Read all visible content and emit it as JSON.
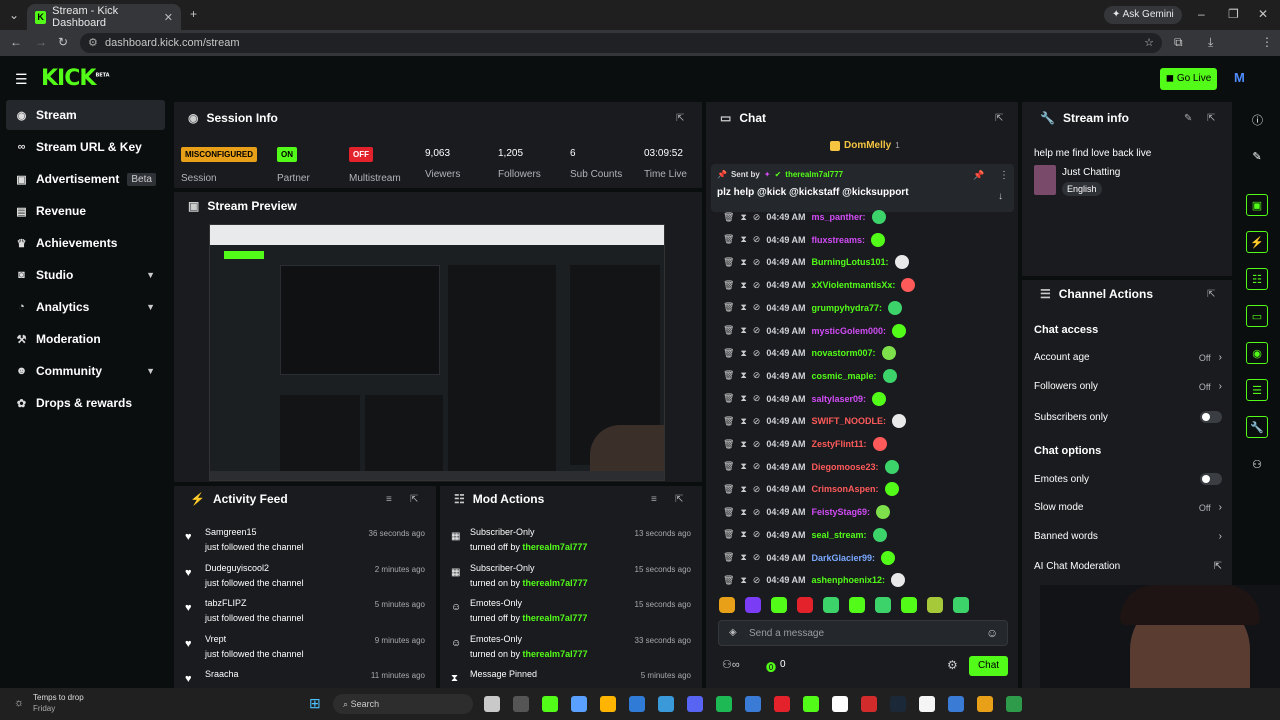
{
  "browser": {
    "tab_title": "Stream - Kick Dashboard",
    "url": "dashboard.kick.com/stream",
    "gemini": "Ask Gemini",
    "profile": "M7"
  },
  "header": {
    "logo": "KICK",
    "logo_sup": "BETA",
    "go_live": "Go Live"
  },
  "sidebar": {
    "items": [
      {
        "label": "Stream",
        "icon": "signal-icon"
      },
      {
        "label": "Stream URL & Key",
        "icon": "link-icon"
      },
      {
        "label": "Advertisement",
        "badge": "Beta",
        "icon": "monitor-icon"
      },
      {
        "label": "Revenue",
        "icon": "money-icon"
      },
      {
        "label": "Achievements",
        "icon": "trophy-icon"
      },
      {
        "label": "Studio",
        "icon": "camera-icon"
      },
      {
        "label": "Analytics",
        "icon": "chart-icon"
      },
      {
        "label": "Moderation",
        "icon": "hammer-icon"
      },
      {
        "label": "Community",
        "icon": "people-icon"
      },
      {
        "label": "Drops & rewards",
        "icon": "gift-icon"
      }
    ]
  },
  "session": {
    "title": "Session Info",
    "session_badge": "MISCONFIGURED",
    "session_label": "Session",
    "partner_badge": "ON",
    "partner_label": "Partner",
    "multistream_badge": "OFF",
    "multistream_label": "Multistream",
    "viewers": "9,063",
    "viewers_label": "Viewers",
    "followers": "1,205",
    "followers_label": "Followers",
    "subs": "6",
    "subs_label": "Sub Counts",
    "time": "03:09:52",
    "time_label": "Time Live"
  },
  "preview": {
    "title": "Stream Preview"
  },
  "activity": {
    "title": "Activity Feed",
    "items": [
      {
        "name": "Samgreen15",
        "action": "just followed the channel",
        "ago": "36 seconds ago"
      },
      {
        "name": "Dudeguyiscool2",
        "action": "just followed the channel",
        "ago": "2 minutes ago"
      },
      {
        "name": "tabzFLIPZ",
        "action": "just followed the channel",
        "ago": "5 minutes ago"
      },
      {
        "name": "Vrept",
        "action": "just followed the channel",
        "ago": "9 minutes ago"
      },
      {
        "name": "Sraacha",
        "action": "",
        "ago": "11 minutes ago"
      }
    ]
  },
  "mod": {
    "title": "Mod Actions",
    "items": [
      {
        "name": "Subscriber-Only",
        "pre": "turned off by",
        "by": "therealm7al777",
        "ago": "13 seconds ago"
      },
      {
        "name": "Subscriber-Only",
        "pre": "turned on by",
        "by": "therealm7al777",
        "ago": "15 seconds ago"
      },
      {
        "name": "Emotes-Only",
        "pre": "turned off by",
        "by": "therealm7al777",
        "ago": "15 seconds ago"
      },
      {
        "name": "Emotes-Only",
        "pre": "turned on by",
        "by": "therealm7al777",
        "ago": "33 seconds ago"
      },
      {
        "name": "Message Pinned",
        "pre": "",
        "by": "",
        "ago": "5 minutes ago"
      }
    ]
  },
  "chat": {
    "title": "Chat",
    "top_gifter": "DomMelly",
    "top_gifter_count": "1",
    "pinned_sent_by": "Sent by",
    "pinned_user": "therealm7al777",
    "pinned_text": "plz help @kick @kickstaff @kicksupport",
    "time": "04:49 AM",
    "messages": [
      {
        "user": "ms_panther:",
        "color": "#d14cf5"
      },
      {
        "user": "fluxstreams:",
        "color": "#d14cf5"
      },
      {
        "user": "BurningLotus101:",
        "color": "#53fc18"
      },
      {
        "user": "xXViolentmantisXx:",
        "color": "#53fc18"
      },
      {
        "user": "grumpyhydra77:",
        "color": "#53fc18"
      },
      {
        "user": "mysticGolem000:",
        "color": "#d14cf5"
      },
      {
        "user": "novastorm007:",
        "color": "#53fc18"
      },
      {
        "user": "cosmic_maple:",
        "color": "#53fc18"
      },
      {
        "user": "saltylaser09:",
        "color": "#d14cf5"
      },
      {
        "user": "SWIFT_NOODLE:",
        "color": "#ff5a5a"
      },
      {
        "user": "ZestyFlint11:",
        "color": "#ff5a5a"
      },
      {
        "user": "Diegomoose23:",
        "color": "#ff5a5a"
      },
      {
        "user": "CrimsonAspen:",
        "color": "#ff5a5a"
      },
      {
        "user": "FeistyStag69:",
        "color": "#d14cf5"
      },
      {
        "user": "seal_stream:",
        "color": "#53fc18"
      },
      {
        "user": "DarkGlacier99:",
        "color": "#7aa8ff"
      },
      {
        "user": "ashenphoenix12:",
        "color": "#53fc18"
      }
    ],
    "placeholder": "Send a message",
    "points": "0",
    "send": "Chat"
  },
  "stream_info": {
    "title": "Stream info",
    "stream_title": "help me find love back live",
    "category": "Just Chatting",
    "language": "English"
  },
  "channel_actions": {
    "title": "Channel Actions",
    "access_heading": "Chat access",
    "account_age": "Account age",
    "account_age_val": "Off",
    "followers_only": "Followers only",
    "followers_only_val": "Off",
    "subscribers_only": "Subscribers only",
    "options_heading": "Chat options",
    "emotes_only": "Emotes only",
    "slow_mode": "Slow mode",
    "slow_mode_val": "Off",
    "banned_words": "Banned words",
    "ai_moderation": "AI Chat Moderation"
  },
  "taskbar": {
    "weather": "Temps to drop",
    "day": "Friday",
    "search": "Search"
  },
  "colors": {
    "accent": "#53fc18",
    "panel": "#191b1f",
    "bg": "#0b0e0f"
  }
}
